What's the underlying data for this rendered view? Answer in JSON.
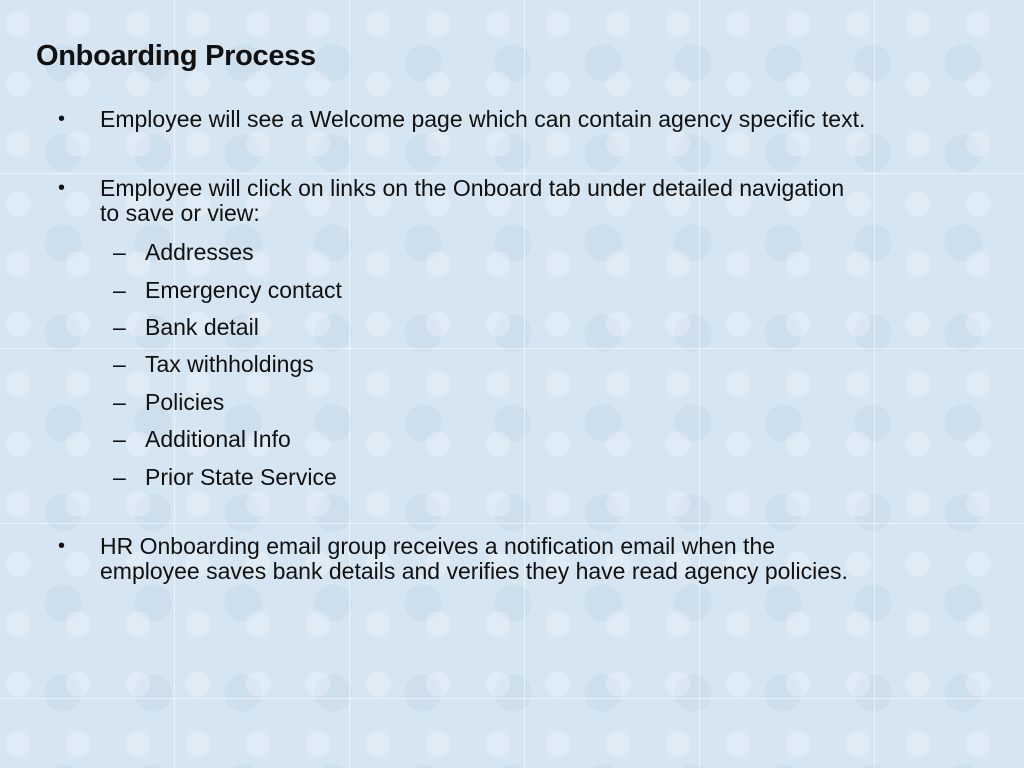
{
  "slide": {
    "title": "Onboarding Process",
    "bullets": [
      {
        "text": "Employee will see a Welcome page which can contain agency specific text."
      },
      {
        "line1": "Employee will click on links on the Onboard tab under detailed navigation",
        "line2": "to save or view:"
      },
      {
        "line1": "HR Onboarding email group receives a notification email when the",
        "line2": "employee saves bank details and verifies they have read agency policies."
      }
    ],
    "sub_items": [
      "Addresses",
      "Emergency contact",
      "Bank detail",
      "Tax withholdings",
      "Policies",
      "Additional Info",
      "Prior State Service"
    ],
    "bullet_glyph": "•",
    "dash_glyph": "–"
  }
}
